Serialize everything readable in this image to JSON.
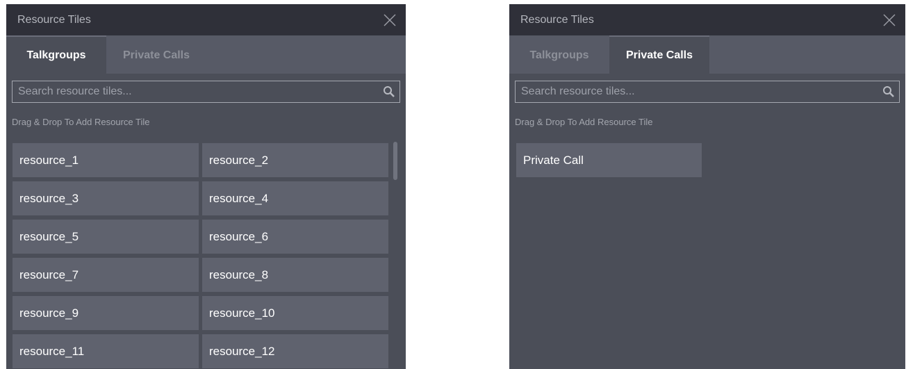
{
  "left_panel": {
    "title": "Resource Tiles",
    "tabs": [
      {
        "label": "Talkgroups",
        "active": true
      },
      {
        "label": "Private Calls",
        "active": false
      }
    ],
    "search": {
      "placeholder": "Search resource tiles...",
      "value": ""
    },
    "hint": "Drag & Drop To Add Resource Tile",
    "tiles": [
      "resource_1",
      "resource_2",
      "resource_3",
      "resource_4",
      "resource_5",
      "resource_6",
      "resource_7",
      "resource_8",
      "resource_9",
      "resource_10",
      "resource_11",
      "resource_12"
    ]
  },
  "right_panel": {
    "title": "Resource Tiles",
    "tabs": [
      {
        "label": "Talkgroups",
        "active": false
      },
      {
        "label": "Private Calls",
        "active": true
      }
    ],
    "search": {
      "placeholder": "Search resource tiles...",
      "value": ""
    },
    "hint": "Drag & Drop To Add Resource Tile",
    "tiles": [
      "Private Call"
    ]
  },
  "colors": {
    "titlebar": "#2f3039",
    "panel_bg": "#4b4e58",
    "tile_bg": "#5f626e",
    "inactive_tab_bg": "#575a66"
  },
  "icons": {
    "close": "close-icon",
    "search": "search-icon"
  }
}
